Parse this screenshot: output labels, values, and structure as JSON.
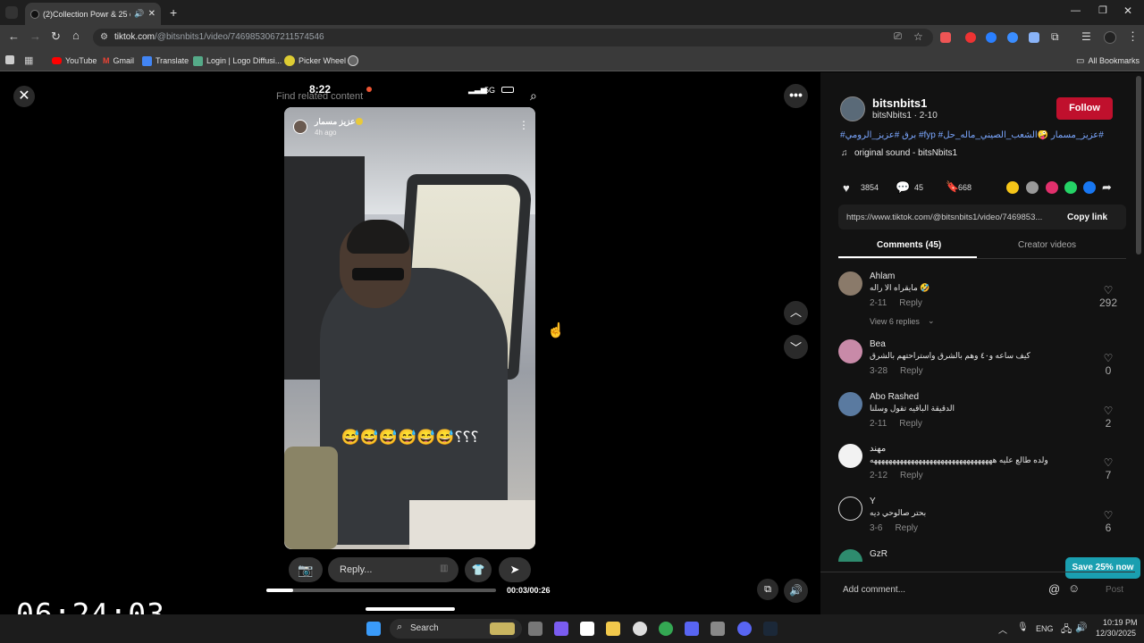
{
  "browser": {
    "tab_title": "(2)Collection Powr & 25 cre",
    "url_domain": "tiktok.com",
    "url_path": "/@bitsnbits1/video/7469853067211574546",
    "bookmarks": [
      "YouTube",
      "Gmail",
      "Translate",
      "Login | Logo Diffusi...",
      "Picker Wheel"
    ],
    "all_bookmarks": "All Bookmarks"
  },
  "video": {
    "status_time": "8:22",
    "status_network": "5G",
    "search_placeholder": "Find related content",
    "story_user": "عزيز مسمار",
    "story_age": "4h ago",
    "caption": "😅😅😅😅😅😅؟؟؟",
    "reply_placeholder": "Reply...",
    "time_progress": "00:03/00:26",
    "progress_fraction": 0.115
  },
  "overlay_clock": "06:24:03",
  "author": {
    "username": "bitsnbits1",
    "handle_date": "bitsNbits1 · 2-10",
    "follow_label": "Follow",
    "hashtags": "#برق #عزيز_الرومي #fyp #عزيز_مسمار 🤪الشعب_الصيني_ماله_حل#",
    "sound": "original sound - bitsNbits1"
  },
  "stats": {
    "likes": "3854",
    "comments": "45",
    "saves": "668"
  },
  "link": {
    "url": "https://www.tiktok.com/@bitsnbits1/video/7469853...",
    "copy_label": "Copy link"
  },
  "tabs": {
    "comments": "Comments (45)",
    "creator": "Creator videos"
  },
  "comments": [
    {
      "name": "Ahlam",
      "text": "مايقراه الا راله 🤣",
      "date": "2-11",
      "reply": "Reply",
      "likes": "292",
      "view_replies": "View 6 replies"
    },
    {
      "name": "Bea",
      "text": "كيف ساعه و٤٠ وهم بالشرق واستراحتهم بالشرق",
      "date": "3-28",
      "reply": "Reply",
      "likes": "0"
    },
    {
      "name": "Abo Rashed",
      "text": "الدقيقة الباقيه تقول وسلنا",
      "date": "2-11",
      "reply": "Reply",
      "likes": "2"
    },
    {
      "name": "مهند",
      "text": "ولده طالع عليه هههههههههههههههههههههههههههههههههه",
      "date": "2-12",
      "reply": "Reply",
      "likes": "7"
    },
    {
      "name": "Y",
      "text": "بحتر صالوحي ديه",
      "date": "3-6",
      "reply": "Reply",
      "likes": "6"
    },
    {
      "name": "GzR",
      "text": "",
      "date": "",
      "reply": "",
      "likes": ""
    }
  ],
  "add_comment": "Add comment...",
  "post_label": "Post",
  "save_banner": "Save 25% now",
  "taskbar": {
    "search": "Search",
    "lang": "ENG",
    "time": "10:19 PM",
    "date": "12/30/2025"
  }
}
